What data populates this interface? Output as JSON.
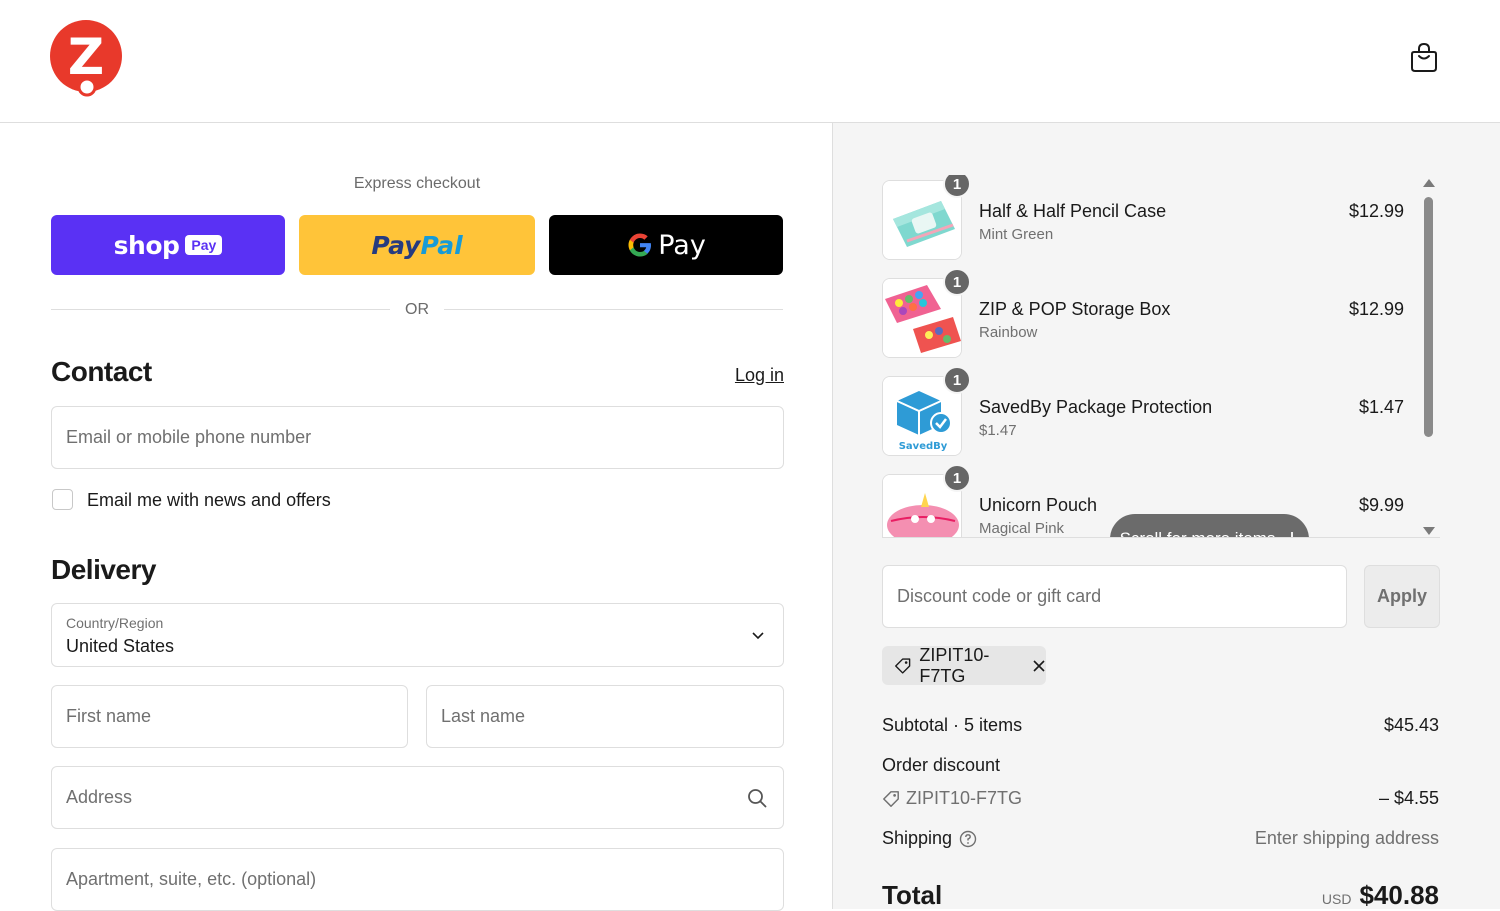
{
  "header": {
    "logo_letter": "Z",
    "cart_icon": "shopping-bag-icon"
  },
  "express": {
    "title": "Express checkout",
    "shop_pay": {
      "word": "shop",
      "tag": "Pay",
      "color": "#5a31f4"
    },
    "paypal": {
      "part1": "Pay",
      "part2": "Pal",
      "color": "#ffc439"
    },
    "gpay": {
      "g": "G",
      "word": "Pay",
      "color": "#000000"
    },
    "or_text": "OR"
  },
  "contact": {
    "title": "Contact",
    "login": "Log in",
    "email_placeholder": "Email or mobile phone number",
    "newsletter_label": "Email me with news and offers"
  },
  "delivery": {
    "title": "Delivery",
    "country_label": "Country/Region",
    "country_value": "United States",
    "first_name_placeholder": "First name",
    "last_name_placeholder": "Last name",
    "address_placeholder": "Address",
    "apartment_placeholder": "Apartment, suite, etc. (optional)"
  },
  "order": {
    "items": [
      {
        "name": "Half & Half Pencil Case",
        "variant": "Mint Green",
        "price": "$12.99",
        "qty": "1"
      },
      {
        "name": "ZIP & POP Storage Box",
        "variant": "Rainbow",
        "price": "$12.99",
        "qty": "1"
      },
      {
        "name": "SavedBy Package Protection",
        "variant": "$1.47",
        "price": "$1.47",
        "qty": "1",
        "thumb_text": "SavedBy"
      },
      {
        "name": "Unicorn Pouch",
        "variant": "Magical Pink",
        "price": "$9.99",
        "qty": "1"
      }
    ],
    "scroll_hint": "Scroll for more items",
    "discount_placeholder": "Discount code or gift card",
    "apply_label": "Apply",
    "applied_code": "ZIPIT10-F7TG",
    "subtotal_label": "Subtotal · 5 items",
    "subtotal_value": "$45.43",
    "discount_label": "Order discount",
    "discount_code": "ZIPIT10-F7TG",
    "discount_value": "– $4.55",
    "shipping_label": "Shipping",
    "shipping_value": "Enter shipping address",
    "total_label": "Total",
    "currency": "USD",
    "total_value": "$40.88"
  },
  "colors": {
    "brand_red": "#e8392b",
    "accent": "#5a31f4"
  }
}
